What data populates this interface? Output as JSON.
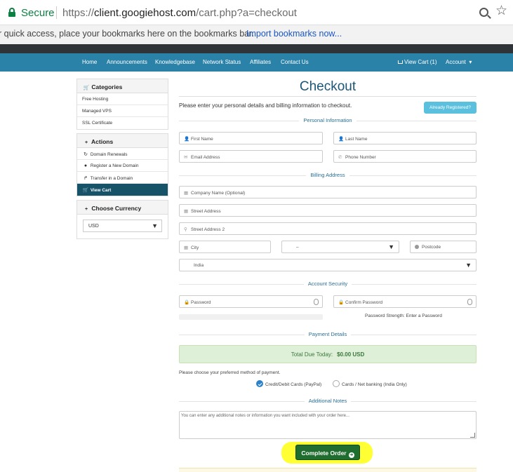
{
  "browser": {
    "secure_label": "Secure",
    "url_scheme": "https://",
    "url_host": "client.googiehost.com",
    "url_path": "/cart.php?a=checkout",
    "bookmarks_text": "r quick access, place your bookmarks here on the bookmarks bar.",
    "bookmarks_link": "Import bookmarks now..."
  },
  "nav": {
    "home": "Home",
    "announcements": "Announcements",
    "knowledgebase": "Knowledgebase",
    "network_status": "Network Status",
    "affiliates": "Affiliates",
    "contact": "Contact Us",
    "view_cart": "View Cart (1)",
    "account": "Account"
  },
  "sidebar": {
    "categories": {
      "title": "Categories",
      "items": [
        "Free Hosting",
        "Managed VPS",
        "SSL Certificate"
      ]
    },
    "actions": {
      "title": "Actions",
      "items": [
        "Domain Renewals",
        "Register a New Domain",
        "Transfer in a Domain",
        "View Cart"
      ]
    },
    "currency": {
      "title": "Choose Currency",
      "selected": "USD"
    }
  },
  "checkout": {
    "title": "Checkout",
    "intro": "Please enter your personal details and billing information to checkout.",
    "already_registered": "Already Registered?",
    "sections": {
      "personal": "Personal Information",
      "billing": "Billing Address",
      "security": "Account Security",
      "payment": "Payment Details",
      "notes": "Additional Notes"
    },
    "placeholders": {
      "first_name": "First Name",
      "last_name": "Last Name",
      "email": "Email Address",
      "phone": "Phone Number",
      "company": "Company Name (Optional)",
      "street": "Street Address",
      "street2": "Street Address 2",
      "city": "City",
      "state": "–",
      "postcode": "Postcode",
      "country": "India",
      "password": "Password",
      "confirm_password": "Confirm Password"
    },
    "strength_text": "Password Strength: Enter a Password",
    "total_label": "Total Due Today:",
    "total_value": "$0.00 USD",
    "payment_prompt": "Please choose your preferred method of payment.",
    "payment_options": [
      "Credit/Debit Cards (PayPal)",
      "Cards / Net banking (India Only)"
    ],
    "notes_placeholder": "You can enter any additional notes or information you want included with your order here...",
    "complete_button": "Complete Order"
  },
  "colors": {
    "nav_bg": "#2b82a8",
    "title": "#1b5775",
    "active_item": "#165268",
    "complete_btn": "#1f6e2f",
    "highlight": "#ffff33",
    "total_bg": "#dff0d8"
  }
}
